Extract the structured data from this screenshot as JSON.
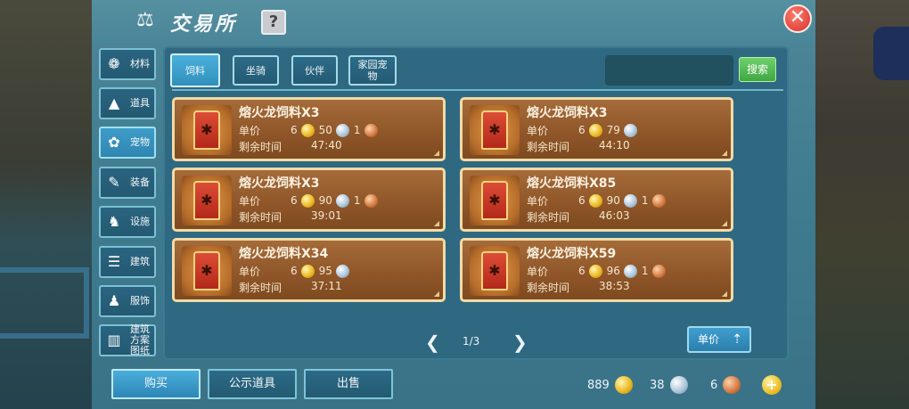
{
  "header": {
    "title": "交易所",
    "title_icon": "scales-icon",
    "help_label": "?",
    "close_label": "✕"
  },
  "sidebar": {
    "items": [
      {
        "label": "材料",
        "icon": "materials-icon",
        "glyph": "❁",
        "active": false
      },
      {
        "label": "道具",
        "icon": "tool-icon",
        "glyph": "▲",
        "active": false
      },
      {
        "label": "宠物",
        "icon": "paw-icon",
        "glyph": "✿",
        "active": true
      },
      {
        "label": "装备",
        "icon": "equipment-icon",
        "glyph": "✎",
        "active": false
      },
      {
        "label": "设施",
        "icon": "facility-icon",
        "glyph": "♞",
        "active": false
      },
      {
        "label": "建筑",
        "icon": "building-icon",
        "glyph": "☰",
        "active": false
      },
      {
        "label": "服饰",
        "icon": "clothing-icon",
        "glyph": "♟",
        "active": false
      },
      {
        "label": "建筑方案图纸",
        "icon": "blueprint-icon",
        "glyph": "▥",
        "active": false
      }
    ]
  },
  "tabs": [
    {
      "label": "饲料",
      "active": true
    },
    {
      "label": "坐骑",
      "active": false
    },
    {
      "label": "伙伴",
      "active": false
    },
    {
      "label": "家园宠物",
      "active": false
    }
  ],
  "search": {
    "value": "",
    "button_label": "搜索"
  },
  "listing_labels": {
    "price_label": "单价",
    "time_label": "剩余时间"
  },
  "listings": [
    {
      "name": "熔火龙饲料X3",
      "gold": "6",
      "silver": "50",
      "copper": "1",
      "time": "47:40"
    },
    {
      "name": "熔火龙饲料X3",
      "gold": "6",
      "silver": "79",
      "copper": "",
      "time": "44:10"
    },
    {
      "name": "熔火龙饲料X3",
      "gold": "6",
      "silver": "90",
      "copper": "1",
      "time": "39:01"
    },
    {
      "name": "熔火龙饲料X85",
      "gold": "6",
      "silver": "90",
      "copper": "1",
      "time": "46:03"
    },
    {
      "name": "熔火龙饲料X34",
      "gold": "6",
      "silver": "95",
      "copper": "",
      "time": "37:11"
    },
    {
      "name": "熔火龙饲料X59",
      "gold": "6",
      "silver": "96",
      "copper": "1",
      "time": "38:53"
    }
  ],
  "pagination": {
    "text": "1/3",
    "prev": "❮",
    "next": "❯"
  },
  "sort": {
    "label": "单价",
    "arrow": "⇡"
  },
  "bottom": {
    "buy_label": "购买",
    "publish_label": "公示道具",
    "sell_label": "出售"
  },
  "wallet": {
    "gold": "889",
    "silver": "38",
    "copper": "6",
    "plus": "+"
  }
}
